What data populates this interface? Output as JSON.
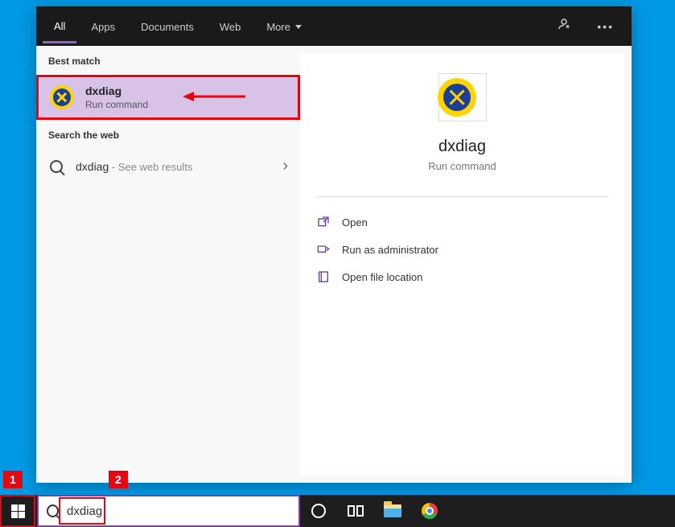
{
  "tabs": {
    "all": "All",
    "apps": "Apps",
    "documents": "Documents",
    "web": "Web",
    "more": "More"
  },
  "sections": {
    "best_match": "Best match",
    "search_web": "Search the web"
  },
  "best_match": {
    "title": "dxdiag",
    "subtitle": "Run command"
  },
  "web": {
    "query": "dxdiag",
    "suffix": " - See web results"
  },
  "preview": {
    "title": "dxdiag",
    "subtitle": "Run command"
  },
  "actions": {
    "open": "Open",
    "run_admin": "Run as administrator",
    "open_location": "Open file location"
  },
  "searchbox": {
    "value": "dxdiag"
  },
  "annotations": {
    "badge1": "1",
    "badge2": "2"
  }
}
